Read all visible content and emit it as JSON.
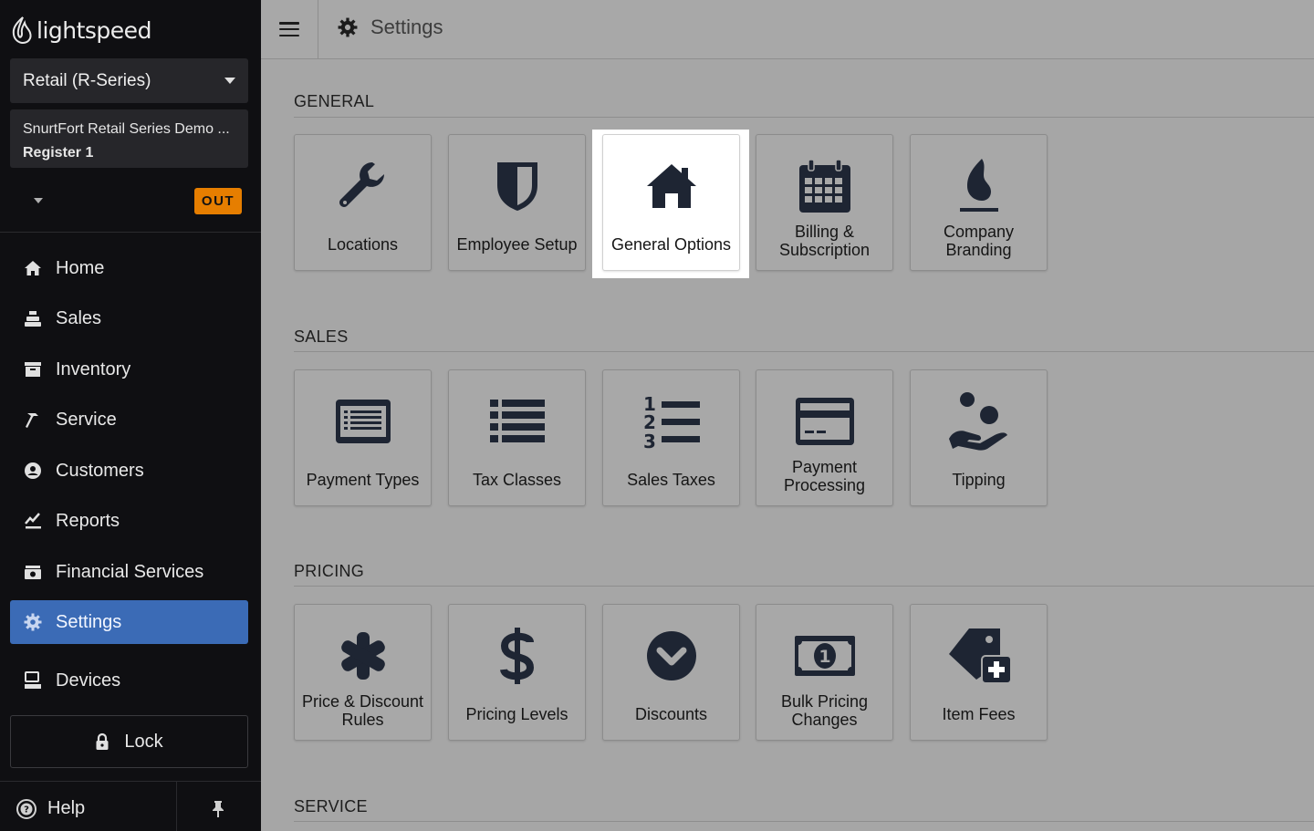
{
  "sidebar": {
    "logo_text": "lightspeed",
    "product": "Retail (R-Series)",
    "account_name": "SnurtFort Retail Series Demo ...",
    "register": "Register 1",
    "status_badge": "OUT",
    "nav": [
      {
        "label": "Home",
        "icon": "home-icon"
      },
      {
        "label": "Sales",
        "icon": "register-icon"
      },
      {
        "label": "Inventory",
        "icon": "inventory-icon"
      },
      {
        "label": "Service",
        "icon": "hammer-icon"
      },
      {
        "label": "Customers",
        "icon": "user-circle-icon"
      },
      {
        "label": "Reports",
        "icon": "chart-icon"
      },
      {
        "label": "Financial Services",
        "icon": "money-icon"
      },
      {
        "label": "Settings",
        "icon": "gear-icon",
        "active": true
      },
      {
        "label": "Devices",
        "icon": "devices-icon"
      }
    ],
    "lock_label": "Lock",
    "help_label": "Help"
  },
  "topbar": {
    "title": "Settings"
  },
  "sections": [
    {
      "title": "GENERAL",
      "tiles": [
        {
          "label": "Locations",
          "icon": "wrench-icon"
        },
        {
          "label": "Employee Setup",
          "icon": "shield-icon"
        },
        {
          "label": "General Options",
          "icon": "house-icon",
          "highlighted": true
        },
        {
          "label": "Billing & Subscription",
          "icon": "calendar-icon"
        },
        {
          "label": "Company Branding",
          "icon": "flame-icon"
        }
      ]
    },
    {
      "title": "SALES",
      "tiles": [
        {
          "label": "Payment Types",
          "icon": "list-card-icon"
        },
        {
          "label": "Tax Classes",
          "icon": "list-icon"
        },
        {
          "label": "Sales Taxes",
          "icon": "numbered-list-icon"
        },
        {
          "label": "Payment Processing",
          "icon": "credit-card-icon"
        },
        {
          "label": "Tipping",
          "icon": "tip-hand-icon"
        }
      ]
    },
    {
      "title": "PRICING",
      "tiles": [
        {
          "label": "Price & Discount Rules",
          "icon": "asterisk-icon"
        },
        {
          "label": "Pricing Levels",
          "icon": "dollar-icon"
        },
        {
          "label": "Discounts",
          "icon": "chevron-circle-icon"
        },
        {
          "label": "Bulk Pricing Changes",
          "icon": "bill-icon"
        },
        {
          "label": "Item Fees",
          "icon": "tag-plus-icon"
        }
      ]
    },
    {
      "title": "SERVICE",
      "tiles": []
    }
  ],
  "colors": {
    "sidebar_bg": "#0f0f12",
    "accent": "#3b6bb6",
    "badge": "#e67e00",
    "icon": "#1e2533"
  }
}
